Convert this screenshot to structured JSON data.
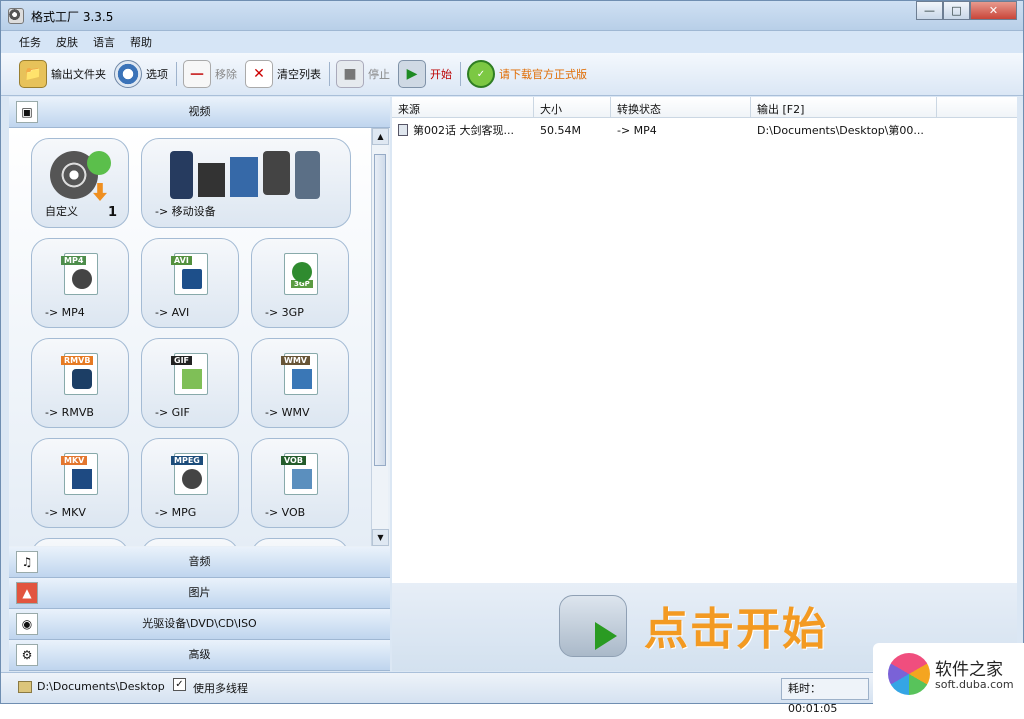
{
  "window": {
    "title": "格式工厂 3.3.5",
    "buttons": [
      "—",
      "□",
      "✕"
    ]
  },
  "menu": [
    "任务",
    "皮肤",
    "语言",
    "帮助"
  ],
  "toolbar": {
    "output_folder": "输出文件夹",
    "options": "选项",
    "remove": "移除",
    "clear_list": "清空列表",
    "stop": "停止",
    "start": "开始",
    "download_notice": "请下载官方正式版"
  },
  "sections": {
    "video": "视频",
    "audio": "音频",
    "image": "图片",
    "device": "光驱设备\\DVD\\CD\\ISO",
    "advanced": "高级"
  },
  "tiles": {
    "custom": "自定义",
    "custom_badge": "1",
    "mobile": "-> 移动设备",
    "mp4": "-> MP4",
    "avi": "-> AVI",
    "3gp": "-> 3GP",
    "rmvb": "-> RMVB",
    "gif": "-> GIF",
    "wmv": "-> WMV",
    "mkv": "-> MKV",
    "mpg": "-> MPG",
    "vob": "-> VOB",
    "tags": {
      "mp4": "MP4",
      "avi": "AVI",
      "3gp": "3GP",
      "rmvb": "RMVB",
      "gif": "GIF",
      "wmv": "WMV",
      "mkv": "MKV",
      "mpeg": "MPEG",
      "vob": "VOB"
    }
  },
  "table": {
    "headers": {
      "source": "来源",
      "size": "大小",
      "status": "转换状态",
      "output": "输出 [F2]"
    },
    "rows": [
      {
        "source": "第002话 大剑客现...",
        "size": "50.54M",
        "status": "-> MP4",
        "output": "D:\\Documents\\Desktop\\第00..."
      }
    ]
  },
  "banner": {
    "text": "点击开始"
  },
  "status": {
    "output_path": "D:\\Documents\\Desktop",
    "multithread": "使用多线程",
    "elapsed": "耗时：00:01:05"
  },
  "watermark": {
    "title": "软件之家",
    "url": "soft.duba.com"
  }
}
